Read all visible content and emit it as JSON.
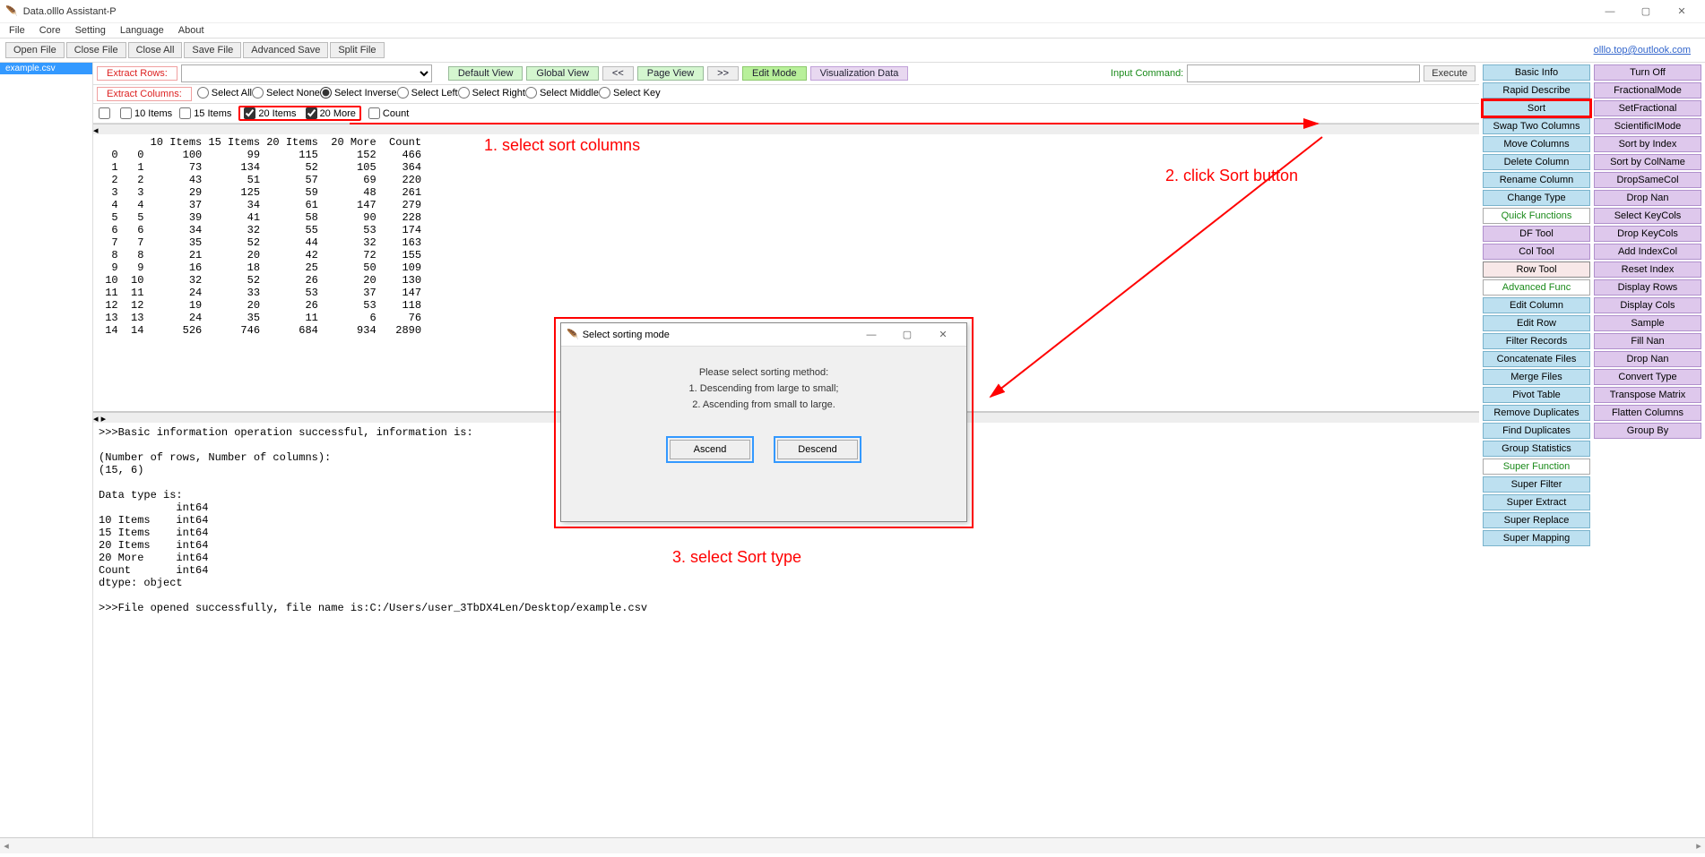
{
  "window": {
    "title": "Data.olllo Assistant-P"
  },
  "menubar": [
    "File",
    "Core",
    "Setting",
    "Language",
    "About"
  ],
  "toolbar": [
    "Open File",
    "Close File",
    "Close All",
    "Save File",
    "Advanced Save",
    "Split File"
  ],
  "email": "olllo.top@outlook.com",
  "file_tab": "example.csv",
  "extract_rows_label": "Extract Rows:",
  "view_buttons": {
    "default": "Default View",
    "global": "Global View",
    "prev": "<<",
    "page": "Page View",
    "next": ">>",
    "edit": "Edit Mode",
    "viz": "Visualization Data"
  },
  "input_cmd_label": "Input Command:",
  "execute_label": "Execute",
  "extract_cols_label": "Extract Columns:",
  "select_radios": [
    "Select All",
    "Select None",
    "Select Inverse",
    "Select Left",
    "Select Right",
    "Select Middle",
    "Select Key"
  ],
  "selected_radio": 2,
  "col_checks": [
    {
      "label": "",
      "checked": false
    },
    {
      "label": "10 Items",
      "checked": false
    },
    {
      "label": "15 Items",
      "checked": false
    },
    {
      "label": "20 Items",
      "checked": true
    },
    {
      "label": "20 More",
      "checked": true
    },
    {
      "label": "Count",
      "checked": false
    }
  ],
  "chart_data": {
    "type": "table",
    "columns": [
      "",
      "",
      "10 Items",
      "15 Items",
      "20 Items",
      "20 More",
      "Count"
    ],
    "rows": [
      [
        0,
        0,
        100,
        99,
        115,
        152,
        466
      ],
      [
        1,
        1,
        73,
        134,
        52,
        105,
        364
      ],
      [
        2,
        2,
        43,
        51,
        57,
        69,
        220
      ],
      [
        3,
        3,
        29,
        125,
        59,
        48,
        261
      ],
      [
        4,
        4,
        37,
        34,
        61,
        147,
        279
      ],
      [
        5,
        5,
        39,
        41,
        58,
        90,
        228
      ],
      [
        6,
        6,
        34,
        32,
        55,
        53,
        174
      ],
      [
        7,
        7,
        35,
        52,
        44,
        32,
        163
      ],
      [
        8,
        8,
        21,
        20,
        42,
        72,
        155
      ],
      [
        9,
        9,
        16,
        18,
        25,
        50,
        109
      ],
      [
        10,
        10,
        32,
        52,
        26,
        20,
        130
      ],
      [
        11,
        11,
        24,
        33,
        53,
        37,
        147
      ],
      [
        12,
        12,
        19,
        20,
        26,
        53,
        118
      ],
      [
        13,
        13,
        24,
        35,
        11,
        6,
        76
      ],
      [
        14,
        14,
        526,
        746,
        684,
        934,
        2890
      ]
    ]
  },
  "log_lines": [
    ">>>Basic information operation successful, information is:",
    "",
    "(Number of rows, Number of columns):",
    "(15, 6)",
    "",
    "Data type is:",
    "            int64",
    "10 Items    int64",
    "15 Items    int64",
    "20 Items    int64",
    "20 More     int64",
    "Count       int64",
    "dtype: object",
    "",
    ">>>File opened successfully, file name is:C:/Users/user_3TbDX4Len/Desktop/example.csv"
  ],
  "panel_left": [
    {
      "t": "Basic Info",
      "c": "blue"
    },
    {
      "t": "Rapid Describe",
      "c": "blue"
    },
    {
      "t": "Sort",
      "c": "blue",
      "hi": true
    },
    {
      "t": "Swap Two Columns",
      "c": "blue"
    },
    {
      "t": "Move Columns",
      "c": "blue"
    },
    {
      "t": "Delete Column",
      "c": "blue"
    },
    {
      "t": "Rename Column",
      "c": "blue"
    },
    {
      "t": "Change Type",
      "c": "blue"
    },
    {
      "t": "Quick Functions",
      "c": "head"
    },
    {
      "t": "DF Tool",
      "c": "purple"
    },
    {
      "t": "Col Tool",
      "c": "purple"
    },
    {
      "t": "Row Tool",
      "c": "pink"
    },
    {
      "t": "Advanced Func",
      "c": "head"
    },
    {
      "t": "Edit Column",
      "c": "blue"
    },
    {
      "t": "Edit Row",
      "c": "blue"
    },
    {
      "t": "Filter Records",
      "c": "blue"
    },
    {
      "t": "Concatenate Files",
      "c": "blue"
    },
    {
      "t": "Merge Files",
      "c": "blue"
    },
    {
      "t": "Pivot Table",
      "c": "blue"
    },
    {
      "t": "Remove Duplicates",
      "c": "blue"
    },
    {
      "t": "Find Duplicates",
      "c": "blue"
    },
    {
      "t": "Group Statistics",
      "c": "blue"
    },
    {
      "t": "Super Function",
      "c": "head"
    },
    {
      "t": "Super Filter",
      "c": "blue"
    },
    {
      "t": "Super Extract",
      "c": "blue"
    },
    {
      "t": "Super Replace",
      "c": "blue"
    },
    {
      "t": "Super Mapping",
      "c": "blue"
    }
  ],
  "panel_right": [
    {
      "t": "Turn Off",
      "c": "purple"
    },
    {
      "t": "FractionalMode",
      "c": "purple"
    },
    {
      "t": "SetFractional",
      "c": "purple"
    },
    {
      "t": "ScientificIMode",
      "c": "purple"
    },
    {
      "t": "Sort by Index",
      "c": "purple"
    },
    {
      "t": "Sort by ColName",
      "c": "purple"
    },
    {
      "t": "DropSameCol",
      "c": "purple"
    },
    {
      "t": "Drop Nan",
      "c": "purple"
    },
    {
      "t": "Select KeyCols",
      "c": "purple"
    },
    {
      "t": "Drop KeyCols",
      "c": "purple"
    },
    {
      "t": "Add IndexCol",
      "c": "purple"
    },
    {
      "t": "Reset Index",
      "c": "purple"
    },
    {
      "t": "Display Rows",
      "c": "purple"
    },
    {
      "t": "Display Cols",
      "c": "purple"
    },
    {
      "t": "Sample",
      "c": "purple"
    },
    {
      "t": "Fill Nan",
      "c": "purple"
    },
    {
      "t": "Drop Nan",
      "c": "purple"
    },
    {
      "t": "Convert Type",
      "c": "purple"
    },
    {
      "t": "Transpose Matrix",
      "c": "purple"
    },
    {
      "t": "Flatten Columns",
      "c": "purple"
    },
    {
      "t": "Group By",
      "c": "purple"
    }
  ],
  "dialog": {
    "title": "Select sorting mode",
    "line1": "Please select sorting method:",
    "line2": "1. Descending from large to small;",
    "line3": "2. Ascending from small to large.",
    "ascend": "Ascend",
    "descend": "Descend"
  },
  "annotations": {
    "a1": "1. select sort columns",
    "a2": "2. click Sort button",
    "a3": "3. select Sort type"
  }
}
